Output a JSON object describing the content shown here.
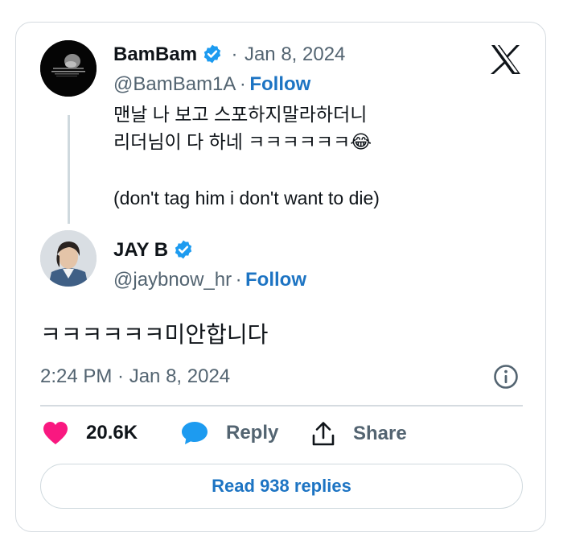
{
  "quoted_tweet": {
    "author_name": "BamBam",
    "separator": "·",
    "date": "Jan 8, 2024",
    "handle": "@BamBam1A",
    "follow_label": "Follow",
    "text_line1": "맨날 나 보고 스포하지말라하더니",
    "text_line2": "리더님이 다 하네 ㅋㅋㅋㅋㅋㅋ😂",
    "text_line3": "(don't tag him i don't want to die)"
  },
  "main_tweet": {
    "author_name": "JAY B",
    "handle": "@jaybnow_hr",
    "separator": "·",
    "follow_label": "Follow",
    "text": "ㅋㅋㅋㅋㅋㅋ미안합니다",
    "timestamp": "2:24 PM · Jan 8, 2024"
  },
  "actions": {
    "likes_count": "20.6K",
    "reply_label": "Reply",
    "share_label": "Share"
  },
  "replies_button_label": "Read 938 replies",
  "colors": {
    "link_blue": "#1d74c3",
    "verified_blue": "#1d9bf0",
    "like_pink": "#f91880",
    "muted_gray": "#536471",
    "border_gray": "#d5dbe0"
  },
  "icons": [
    "x-logo-icon",
    "verified-badge-icon",
    "info-icon",
    "heart-icon",
    "reply-bubble-icon",
    "share-icon"
  ]
}
